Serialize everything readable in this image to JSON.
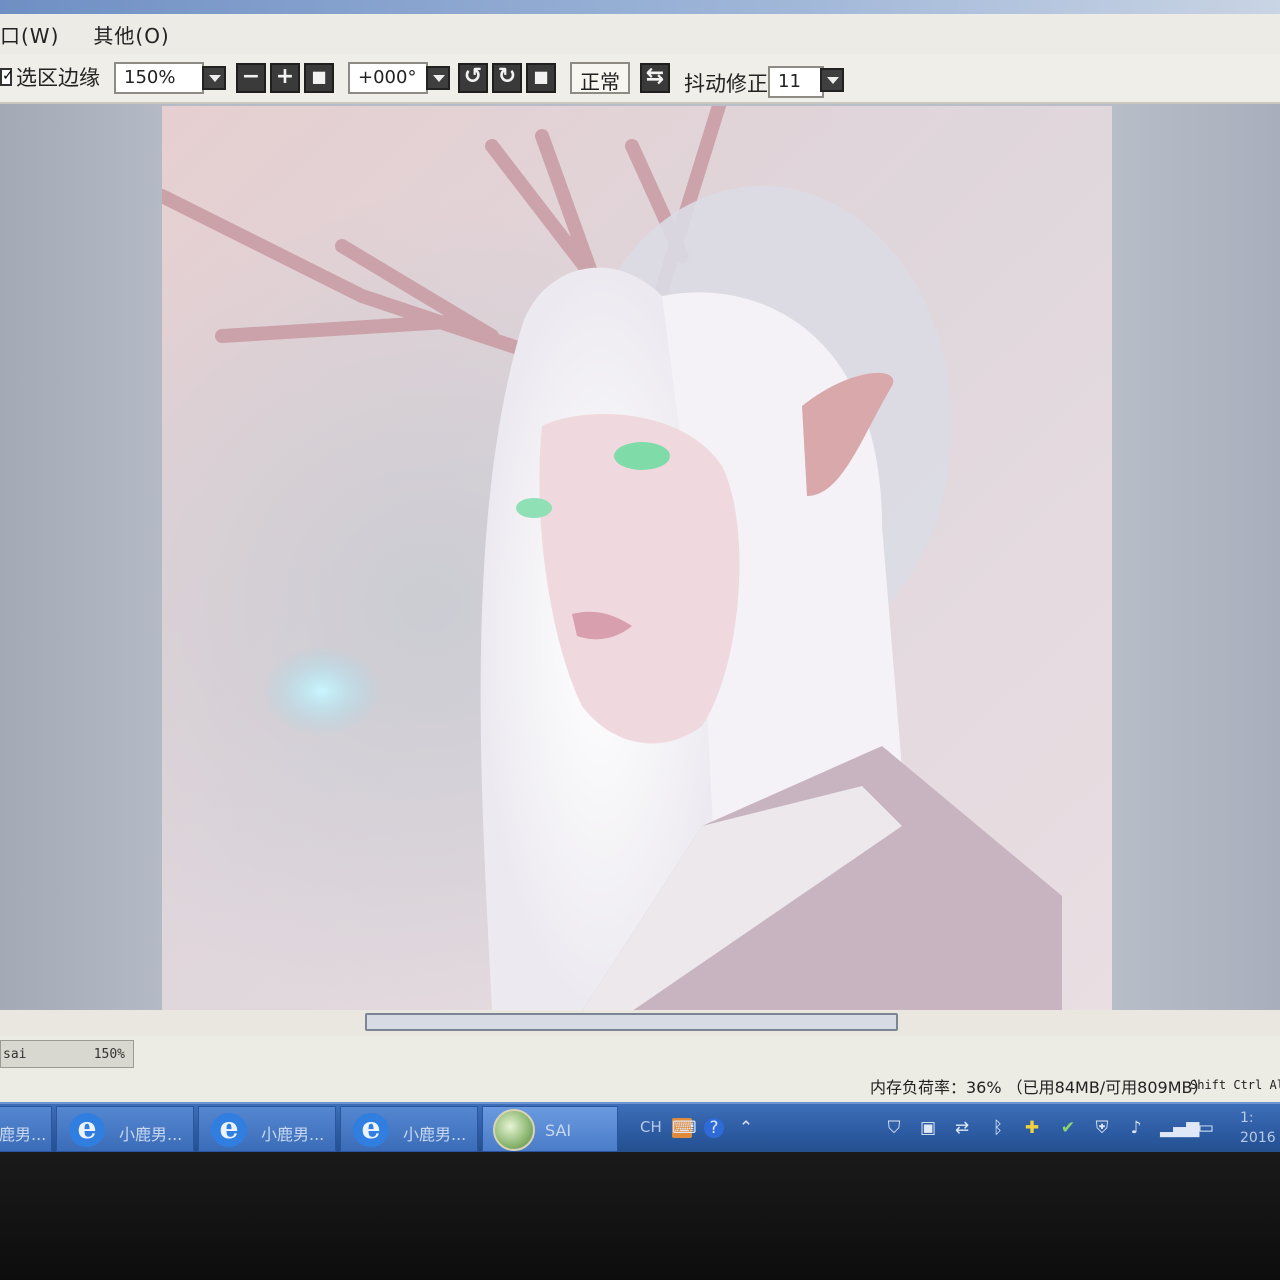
{
  "menubar": {
    "items": [
      {
        "label": "口(W)"
      },
      {
        "label": "其他(O)"
      }
    ]
  },
  "toolbar": {
    "selection_edge_checked": true,
    "selection_edge_label": "选区边缘",
    "zoom_value": "150%",
    "angle_value": "+000°",
    "blend_mode_label": "正常",
    "stabilizer_label": "抖动修正",
    "stabilizer_value": "11",
    "zoom_out_symbol": "−",
    "zoom_in_symbol": "+",
    "zoom_reset_symbol": "■",
    "rotate_ccw_symbol": "↺",
    "rotate_cw_symbol": "↻",
    "rotate_reset_symbol": "■",
    "flip_symbol": "⇆"
  },
  "canvas": {
    "scroll_position": 0.49
  },
  "document_tab": {
    "name": "sai",
    "zoom": "150%"
  },
  "status": {
    "memory": "内存负荷率：36% （已用84MB/可用809MB）",
    "modifier_keys": "Shift Ctrl Alt S"
  },
  "taskbar": {
    "tasks": [
      {
        "label": "鹿男...",
        "icon": "window-icon"
      },
      {
        "label": "小鹿男...",
        "icon": "ie-icon"
      },
      {
        "label": "小鹿男...",
        "icon": "ie-icon"
      },
      {
        "label": "小鹿男...",
        "icon": "ie-icon"
      },
      {
        "label": "SAI",
        "icon": "sai-app-icon"
      }
    ],
    "ie_glyph": "e",
    "tray": {
      "language": "CH",
      "clock_time": "1:",
      "clock_date": "2016"
    }
  }
}
